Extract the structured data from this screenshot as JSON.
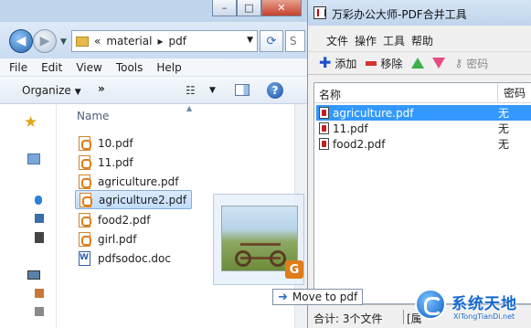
{
  "explorer": {
    "window_buttons": [
      "–",
      "□",
      "✕"
    ],
    "address": {
      "prefix": "«",
      "path": [
        "material",
        "pdf"
      ],
      "separator": "▸",
      "search_placeholder": "S"
    },
    "menu": [
      "File",
      "Edit",
      "View",
      "Tools",
      "Help"
    ],
    "toolbar": {
      "organize_label": "Organize",
      "more_label": "»"
    },
    "column_header": "Name",
    "files": [
      {
        "name": "10.pdf",
        "type": "pdf",
        "selected": false
      },
      {
        "name": "11.pdf",
        "type": "pdf",
        "selected": false
      },
      {
        "name": "agriculture.pdf",
        "type": "pdf",
        "selected": false
      },
      {
        "name": "agriculture2.pdf",
        "type": "pdf",
        "selected": true
      },
      {
        "name": "food2.pdf",
        "type": "pdf",
        "selected": false
      },
      {
        "name": "girl.pdf",
        "type": "pdf",
        "selected": false
      },
      {
        "name": "pdfsodoc.doc",
        "type": "doc",
        "selected": false
      }
    ],
    "drag_tooltip": {
      "arrow": "➜",
      "text": "Move to pdf"
    }
  },
  "app": {
    "title": "万彩办公大师-PDF合并工具",
    "menu": [
      "文件",
      "操作",
      "工具",
      "帮助"
    ],
    "toolbar": {
      "add_label": "添加",
      "remove_label": "移除",
      "password_label": "密码"
    },
    "columns": [
      "名称",
      "密码"
    ],
    "rows": [
      {
        "name": "agriculture.pdf",
        "password": "无",
        "selected": true
      },
      {
        "name": "11.pdf",
        "password": "无",
        "selected": false
      },
      {
        "name": "food2.pdf",
        "password": "无",
        "selected": false
      }
    ],
    "status": {
      "count_text": "合计: 3个文件",
      "extra_text": "[属"
    }
  },
  "watermark": {
    "title": "系统天地",
    "subtitle": "XiTongTianDi.net"
  }
}
